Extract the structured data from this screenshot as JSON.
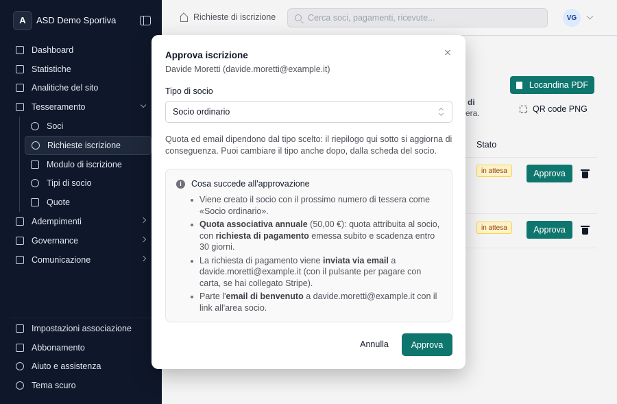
{
  "sidebar": {
    "brand_initial": "A",
    "brand_name": "ASD Demo Sportiva",
    "items": [
      {
        "label": "Dashboard",
        "icon": "home-icon"
      },
      {
        "label": "Statistiche",
        "icon": "bar-chart-icon"
      },
      {
        "label": "Analitiche del sito",
        "icon": "analytics-icon"
      },
      {
        "label": "Tesseramento",
        "icon": "id-card-icon",
        "expanded": true,
        "children": [
          {
            "label": "Soci",
            "icon": "users-icon"
          },
          {
            "label": "Richieste iscrizione",
            "icon": "user-plus-icon",
            "active": true
          },
          {
            "label": "Modulo di iscrizione",
            "icon": "form-icon"
          },
          {
            "label": "Tipi di socio",
            "icon": "user-tag-icon"
          },
          {
            "label": "Quote",
            "icon": "tag-icon"
          }
        ]
      },
      {
        "label": "Adempimenti",
        "icon": "document-icon"
      },
      {
        "label": "Governance",
        "icon": "scales-icon"
      },
      {
        "label": "Comunicazione",
        "icon": "megaphone-icon"
      }
    ],
    "bottom_items": [
      {
        "label": "Impostazioni associazione",
        "icon": "building-icon"
      },
      {
        "label": "Abbonamento",
        "icon": "crown-icon"
      },
      {
        "label": "Aiuto e assistenza",
        "icon": "lifebuoy-icon"
      },
      {
        "label": "Tema scuro",
        "icon": "moon-icon"
      }
    ]
  },
  "topbar": {
    "breadcrumb": "Richieste di iscrizione",
    "search_placeholder": "Cerca soci, pagamenti, ricevute...",
    "user_initials": "VG"
  },
  "background": {
    "pdf_button": "Locandina PDF",
    "qr_button": "QR code PNG",
    "partial_text_1": "di",
    "partial_text_2": "era.",
    "status_header": "Stato",
    "rows": [
      {
        "status": "in attesa",
        "action": "Approva"
      },
      {
        "status": "in attesa",
        "action": "Approva"
      }
    ]
  },
  "modal": {
    "title": "Approva iscrizione",
    "subtitle": "Davide Moretti (davide.moretti@example.it)",
    "field_label": "Tipo di socio",
    "selected_type": "Socio ordinario",
    "help_text": "Quota ed email dipendono dal tipo scelto: il riepilogo qui sotto si aggiorna di conseguenza. Puoi cambiare il tipo anche dopo, dalla scheda del socio.",
    "info_title": "Cosa succede all'approvazione",
    "info_items": [
      {
        "parts": [
          {
            "t": "Viene creato il socio con il prossimo numero di tessera come «Socio ordinario».",
            "b": false
          }
        ]
      },
      {
        "parts": [
          {
            "t": "Quota associativa annuale",
            "b": true
          },
          {
            "t": " (50,00 €): quota attribuita al socio, con ",
            "b": false
          },
          {
            "t": "richiesta di pagamento",
            "b": true
          },
          {
            "t": " emessa subito e scadenza entro 30 giorni.",
            "b": false
          }
        ]
      },
      {
        "parts": [
          {
            "t": "La richiesta di pagamento viene ",
            "b": false
          },
          {
            "t": "inviata via email",
            "b": true
          },
          {
            "t": " a davide.moretti@example.it (con il pulsante per pagare con carta, se hai collegato Stripe).",
            "b": false
          }
        ]
      },
      {
        "parts": [
          {
            "t": "Parte l'",
            "b": false
          },
          {
            "t": "email di benvenuto",
            "b": true
          },
          {
            "t": " a davide.moretti@example.it con il link all'area socio.",
            "b": false
          }
        ]
      }
    ],
    "cancel_label": "Annulla",
    "approve_label": "Approva"
  },
  "colors": {
    "sidebar_bg": "#0f172a",
    "accent": "#0f766e",
    "badge_bg": "#fef3c7"
  }
}
